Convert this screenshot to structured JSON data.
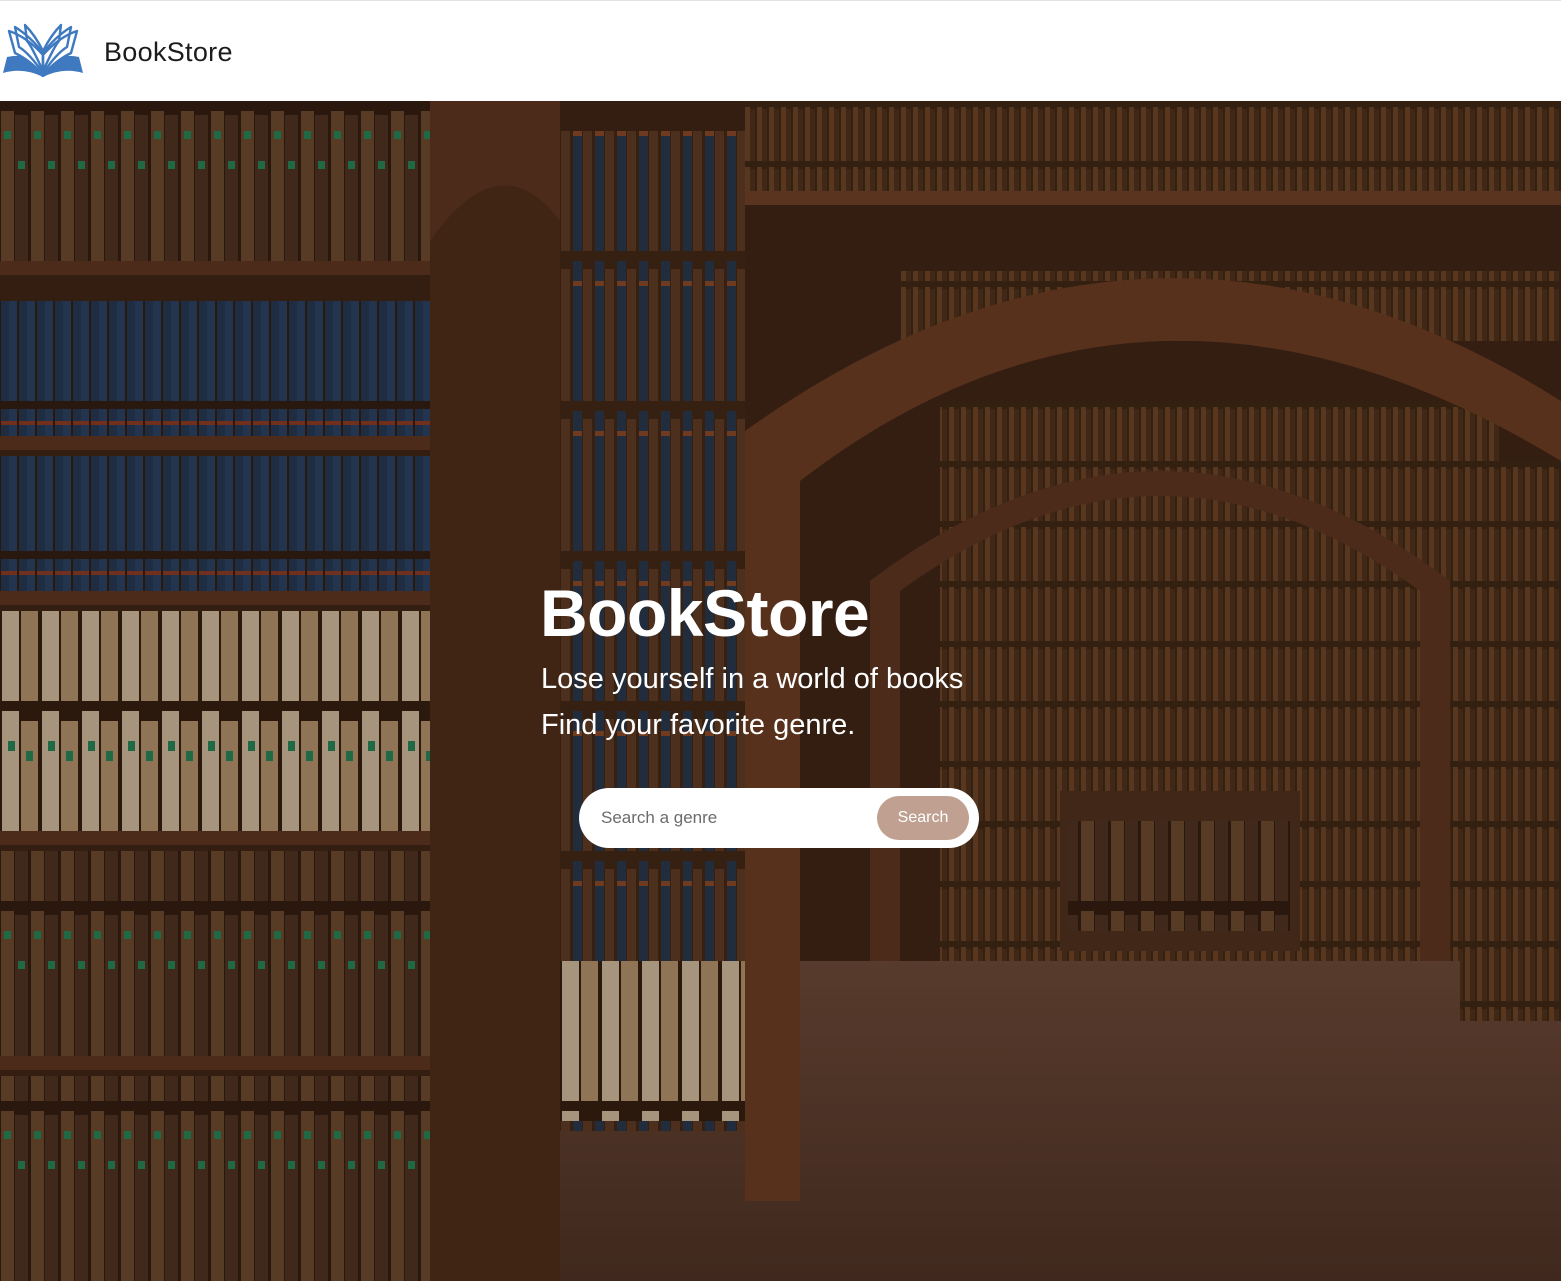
{
  "navbar": {
    "brand_name": "BookStore",
    "logo_icon": "open-book-icon",
    "logo_color": "#3f7ac0"
  },
  "hero": {
    "title": "BookStore",
    "subtitle_line1": "Lose yourself in a world of books",
    "subtitle_line2": "Find your favorite genre.",
    "background_image": "library-bookshelves-arches"
  },
  "search": {
    "placeholder": "Search a genre",
    "value": "",
    "button_label": "Search",
    "button_color": "#bfa091"
  }
}
